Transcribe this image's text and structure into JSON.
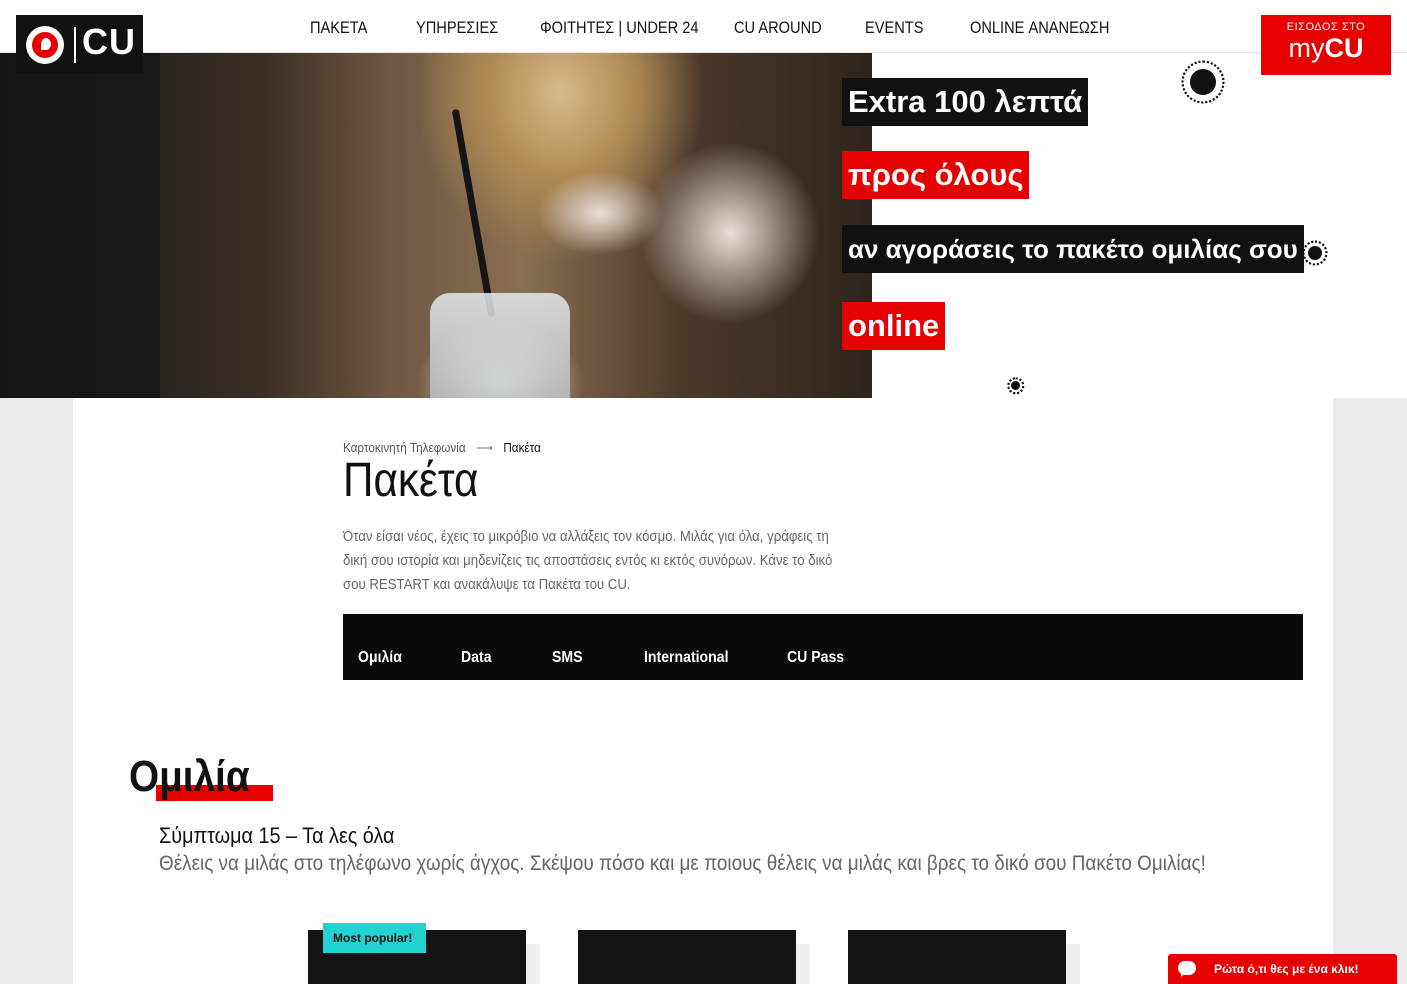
{
  "logo": {
    "brand": "CU"
  },
  "nav": {
    "items": [
      "ΠΑΚΕΤΑ",
      "ΥΠΗΡΕΣΙΕΣ",
      "ΦΟΙΤΗΤΕΣ | UNDER 24",
      "CU AROUND",
      "EVENTS",
      "ONLINE ΑΝΑΝΕΩΣΗ"
    ]
  },
  "mycu": {
    "line1": "ΕΙΣΟΔΟΣ ΣΤΟ",
    "my": "my",
    "cu": "CU"
  },
  "hero": {
    "line1": "Extra 100 λεπτά",
    "line2": "προς όλους",
    "line3": "αν αγοράσεις το πακέτο ομιλίας σου",
    "line4": "online"
  },
  "breadcrumb": {
    "parent": "Καρτοκινητή Τηλεφωνία",
    "arrow": "⟶",
    "current": "Πακέτα"
  },
  "page": {
    "title": "Πακέτα",
    "intro": "Όταν είσαι νέος, έχεις το μικρόβιο να αλλάξεις τον κόσμο. Μιλάς για όλα, γράφεις τη δική σου ιστορία και μηδενίζεις τις αποστάσεις εντός κι εκτός συνόρων. Κάνε το δικό σου RESTART και ανακάλυψε τα Πακέτα του CU."
  },
  "tabs": [
    "Ομιλία",
    "Data",
    "SMS",
    "International",
    "CU Pass"
  ],
  "section": {
    "title": "Ομιλία",
    "subtitle": "Σύμπτωμα 15 – Τα λες όλα",
    "description": "Θέλεις να μιλάς στο τηλέφωνο χωρίς άγχος. Σκέψου πόσο και με ποιους θέλεις να μιλάς και βρες το δικό σου Πακέτο Ομιλίας!"
  },
  "cards": {
    "badge": "Most popular!"
  },
  "chat": {
    "label": "Ρώτα ό,τι θες με ένα κλικ!"
  },
  "colors": {
    "brand_red": "#e60000",
    "black": "#111111",
    "badge_cyan": "#21d3d0"
  }
}
